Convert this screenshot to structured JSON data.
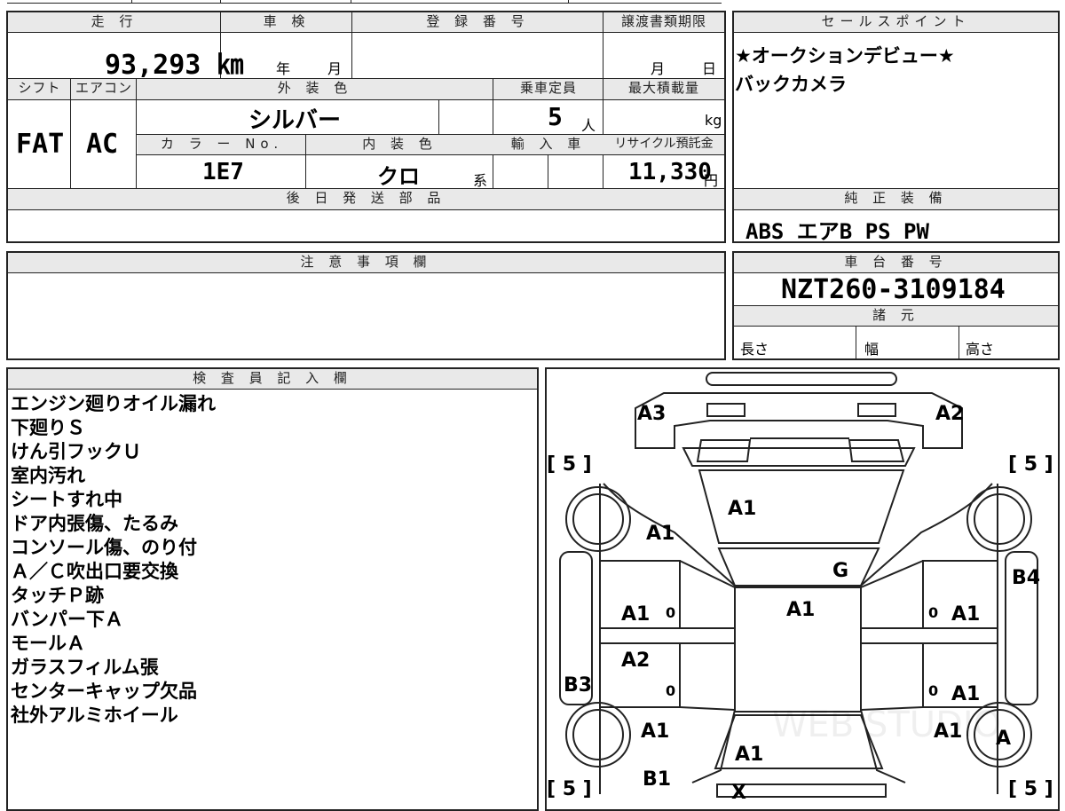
{
  "vehicle": {
    "mileage_header": "走 行",
    "mileage": "93,293 ㎞",
    "inspection_header": "車 検",
    "inspection_year_label": "年",
    "inspection_month_label": "月",
    "registration_header": "登 録 番 号",
    "transfer_header": "譲渡書類期限",
    "transfer_month_label": "月",
    "transfer_day_label": "日",
    "shift_header": "シフト",
    "ac_header": "エアコン",
    "exterior_color_header": "外 装 色",
    "capacity_header": "乗車定員",
    "max_load_header": "最大積載量",
    "shift": "FAT",
    "ac": "AC",
    "exterior_color": "シルバー",
    "capacity": "5",
    "capacity_unit": "人",
    "max_load_unit": "kg",
    "color_no_header": "カ ラ ー No.",
    "interior_color_header": "内 装 色",
    "import_header": "輸 入 車",
    "recycle_header": "リサイクル預託金",
    "color_no": "1E7",
    "interior_color": "クロ",
    "interior_color_suffix": "系",
    "recycle_fee": "11,330",
    "recycle_unit": "円",
    "later_parts_header": "後 日 発 送 部 品"
  },
  "sales": {
    "header": "セールスポイント",
    "points": [
      "★オークションデビュー★",
      "バックカメラ"
    ]
  },
  "equipment": {
    "header": "純 正 装 備",
    "items": "ABS エアB PS PW"
  },
  "notes": {
    "header": "注 意 事 項 欄"
  },
  "chassis": {
    "header": "車 台 番 号",
    "number": "NZT260-3109184",
    "spec_header": "諸 元",
    "length_label": "長さ",
    "width_label": "幅",
    "height_label": "高さ"
  },
  "inspector": {
    "header": "検 査 員 記 入 欄",
    "items": [
      "エンジン廻りオイル漏れ",
      "下廻りＳ",
      "けん引フックＵ",
      "室内汚れ",
      "シートすれ中",
      "ドア内張傷、たるみ",
      "コンソール傷、のり付",
      "Ａ／Ｃ吹出口要交換",
      "タッチＰ跡",
      "バンパー下Ａ",
      "モールＡ",
      "ガラスフィルム張",
      "センターキャップ欠品",
      "社外アルミホイール"
    ]
  },
  "diagram": {
    "tread_label": "[ 5 ]",
    "marks": {
      "a3": "A3",
      "a2_top": "A2",
      "a1_hood": "A1",
      "a1_lfender": "A1",
      "g": "G",
      "b4": "B4",
      "a1_roof": "A1",
      "a1_ldoor_front": "A1",
      "a1_rdoor_front": "A1",
      "a2_ldoor_rear": "A2",
      "b3": "B3",
      "a1_rdoor_rear": "A1",
      "a1_lrear": "A1",
      "a1_rrear": "A1",
      "a1_trunk": "A1",
      "a_wheel": "A",
      "b1": "B1",
      "x": "X",
      "zero": "0"
    },
    "watermark": "WEB STUDIO"
  }
}
